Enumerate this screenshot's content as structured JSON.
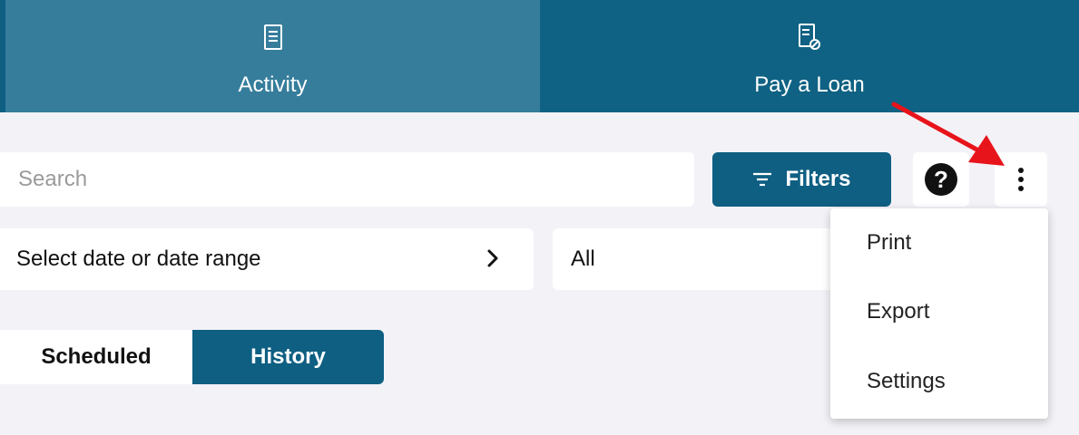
{
  "tabs": [
    {
      "label": "Activity",
      "icon": "receipt-icon"
    },
    {
      "label": "Pay a Loan",
      "icon": "pay-loan-icon"
    }
  ],
  "search": {
    "placeholder": "Search",
    "value": ""
  },
  "filters": {
    "label": "Filters",
    "icon": "filter-lines-icon"
  },
  "help": {
    "label": "?",
    "icon": "help-icon"
  },
  "more": {
    "icon": "more-vertical-icon"
  },
  "date_range": {
    "label": "Select date or date range",
    "icon": "chevron-right-icon"
  },
  "type_select": {
    "value": "All"
  },
  "segments": [
    {
      "label": "Scheduled",
      "selected": false
    },
    {
      "label": "History",
      "selected": true
    }
  ],
  "menu": {
    "items": [
      {
        "label": "Print"
      },
      {
        "label": "Export"
      },
      {
        "label": "Settings"
      }
    ]
  },
  "annotation": {
    "icon": "red-arrow-icon",
    "color": "#e8141b"
  },
  "colors": {
    "primary": "#0e5f82",
    "tab_active": "#367d9c",
    "background": "#f3f2f7"
  }
}
